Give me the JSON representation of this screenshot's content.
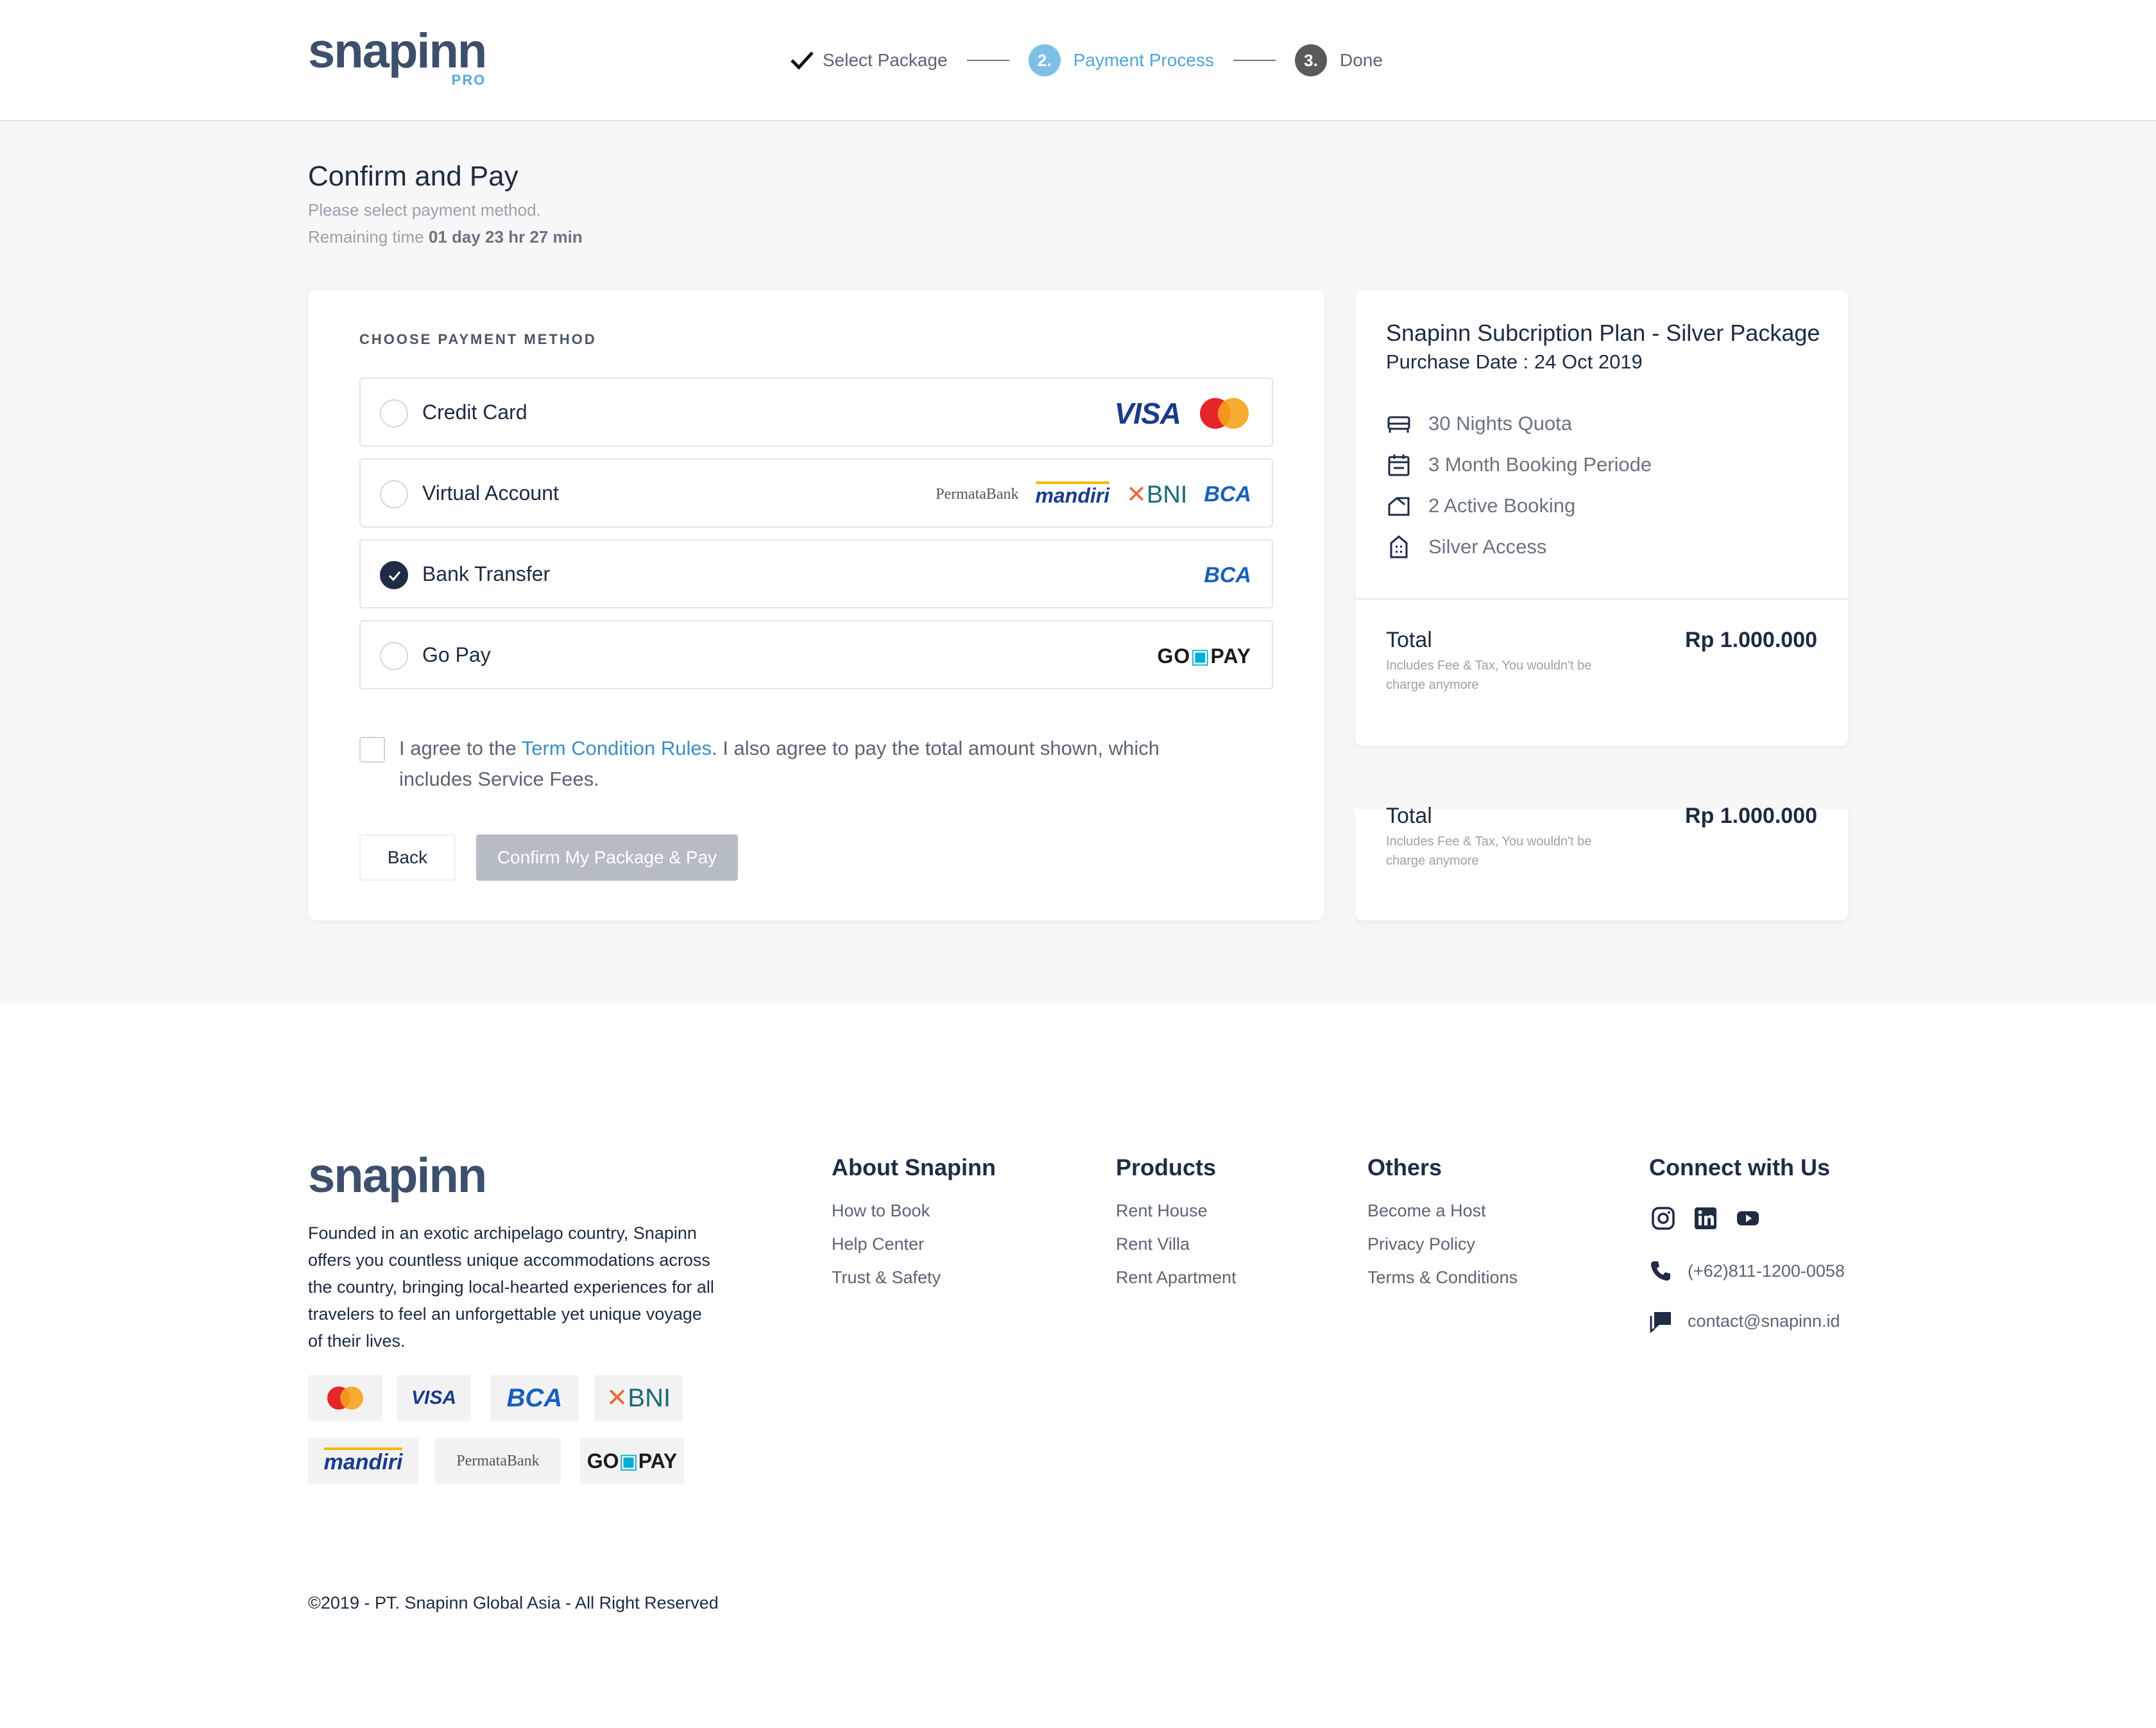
{
  "header": {
    "logo": "snapinn",
    "logo_sub": "PRO",
    "steps": [
      {
        "num": "",
        "label": "Select Package"
      },
      {
        "num": "2.",
        "label": "Payment Process"
      },
      {
        "num": "3.",
        "label": "Done"
      }
    ]
  },
  "page": {
    "title": "Confirm and Pay",
    "subtitle": "Please select payment method.",
    "remaining_label": "Remaining time",
    "remaining_value": "01 day 23 hr 27 min"
  },
  "payment": {
    "section_label": "CHOOSE PAYMENT METHOD",
    "methods": [
      {
        "label": "Credit Card",
        "selected": false,
        "logos": [
          "VISA",
          "MasterCard"
        ]
      },
      {
        "label": "Virtual Account",
        "selected": false,
        "logos": [
          "PermataBank",
          "mandiri",
          "BNI",
          "BCA"
        ]
      },
      {
        "label": "Bank Transfer",
        "selected": true,
        "logos": [
          "BCA"
        ]
      },
      {
        "label": "Go Pay",
        "selected": false,
        "logos": [
          "GO",
          "PAY"
        ]
      }
    ],
    "agree_prefix": "I agree to the",
    "agree_link": "Term Condition Rules",
    "agree_suffix": ". I also agree to pay the total amount shown, which includes Service Fees.",
    "back_label": "Back",
    "confirm_label": "Confirm My Package & Pay"
  },
  "summary": {
    "plan_title": "Snapinn Subcription Plan - Silver Package",
    "purchase_date": "Purchase Date : 24 Oct 2019",
    "features": [
      {
        "icon": "bed-icon",
        "label": "30 Nights Quota"
      },
      {
        "icon": "calendar-icon",
        "label": "3 Month Booking Periode"
      },
      {
        "icon": "house-icon",
        "label": "2 Active Booking"
      },
      {
        "icon": "building-icon",
        "label": "Silver Access"
      }
    ],
    "total_label": "Total",
    "total_note": "Includes Fee & Tax, You wouldn't be charge anymore",
    "total_value": "Rp 1.000.000"
  },
  "footer": {
    "logo": "snapinn",
    "about": "Founded in an exotic archipelago country, Snapinn offers you countless unique accommodations across the country, bringing local-hearted experiences for all travelers to feel an unforgettable yet unique voyage of their lives.",
    "payment_logos": [
      "MasterCard",
      "VISA",
      "BCA",
      "BNI",
      "mandiri",
      "PermataBank",
      "GO",
      "PAY"
    ],
    "columns": [
      {
        "title": "About Snapinn",
        "links": [
          "How to Book",
          "Help Center",
          "Trust & Safety"
        ]
      },
      {
        "title": "Products",
        "links": [
          "Rent House",
          "Rent Villa",
          "Rent Apartment"
        ]
      },
      {
        "title": "Others",
        "links": [
          "Become a Host",
          "Privacy Policy",
          "Terms & Conditions"
        ]
      }
    ],
    "connect_title": "Connect with Us",
    "phone": "(+62)811-1200-0058",
    "email": "contact@snapinn.id",
    "copyright": "©2019 - PT. Snapinn Global Asia - All Right Reserved"
  },
  "colors": {
    "brand": "#3d4f6d",
    "accent": "#4ea5d9",
    "navy": "#1f2c44",
    "disabled_button": "#b6bcc6"
  }
}
